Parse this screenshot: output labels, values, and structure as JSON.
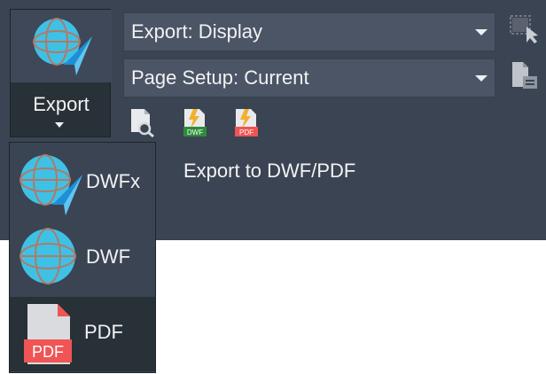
{
  "export_button": {
    "label": "Export"
  },
  "dropdowns": {
    "export": {
      "value": "Export: Display"
    },
    "page_setup": {
      "value": "Page Setup: Current"
    }
  },
  "tools": {
    "dwf_badge": "DWF",
    "pdf_badge": "PDF"
  },
  "group_title": "Export to DWF/PDF",
  "menu": {
    "items": [
      {
        "label": "DWFx"
      },
      {
        "label": "DWF"
      },
      {
        "label": "PDF",
        "badge": "PDF"
      }
    ]
  },
  "colors": {
    "panel_bg": "#3b4453",
    "dropdown_bg": "#4b5566",
    "globe": "#3fc1e6",
    "pdf_red": "#f05454",
    "dwf_green": "#2e8b3a"
  }
}
